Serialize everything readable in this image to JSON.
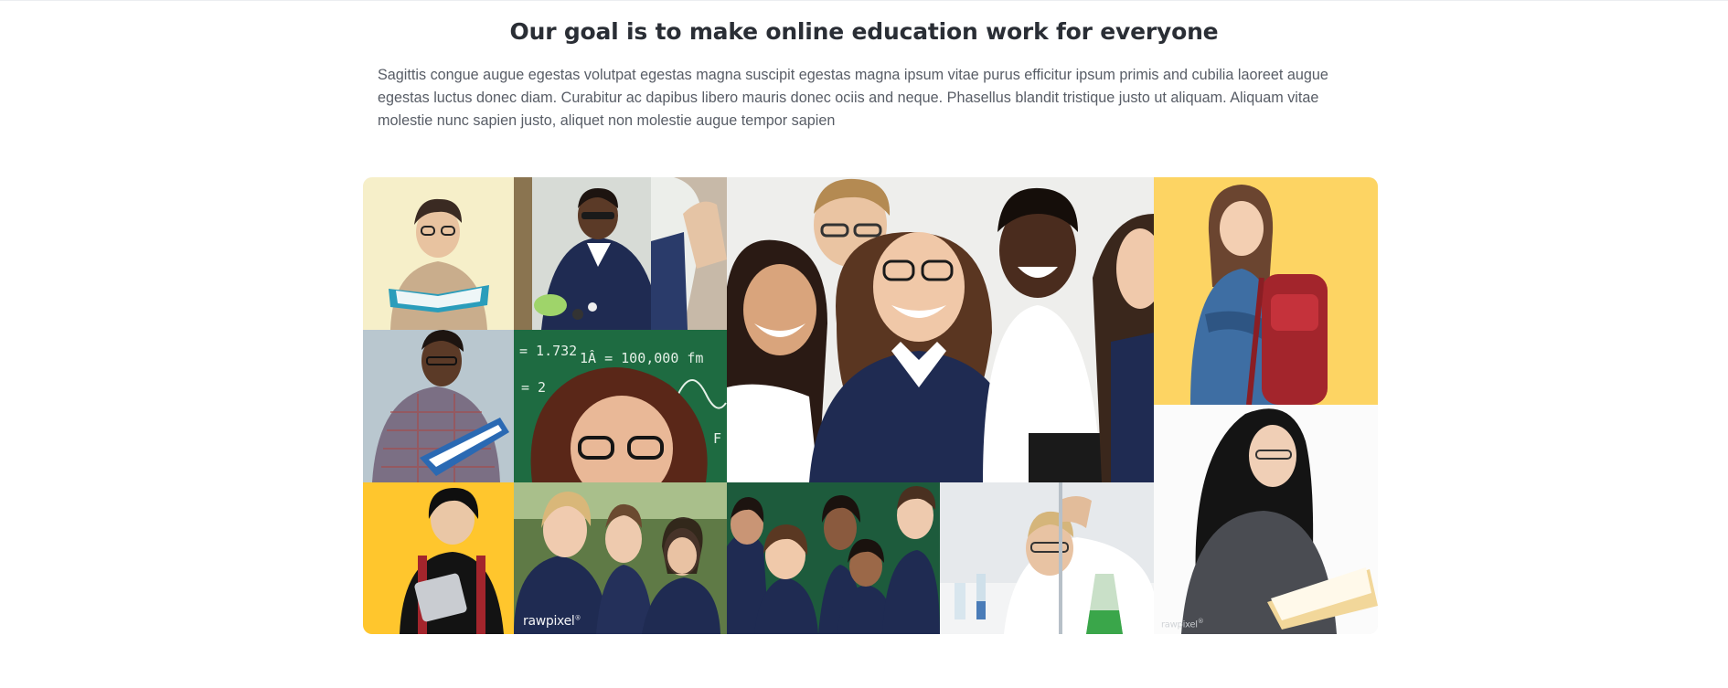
{
  "section": {
    "heading": "Our goal is to make online education work for everyone",
    "paragraph": "Sagittis congue augue egestas volutpat egestas magna suscipit egestas magna ipsum vitae purus efficitur ipsum primis and cubilia laoreet augue egestas luctus donec diam. Curabitur ac dapibus libero mauris donec ociis and neque. Phasellus blandit tristique justo ut aliquam. Aliquam vitae molestie nunc sapien justo, aliquet non molestie augue tempor sapien"
  },
  "collage": {
    "watermarks": [
      "rawpixel",
      "rawpixel"
    ],
    "blackboard_text": [
      "= 1.732",
      "1Â = 100,000 fm",
      "= 2",
      "F"
    ],
    "colors": {
      "cream": "#f6efc9",
      "yellow": "#fdd463",
      "yellow_bright": "#ffc62d",
      "green_board": "#1e6b41",
      "navy": "#1f2b52",
      "grey_blue": "#b9c7cf"
    }
  }
}
